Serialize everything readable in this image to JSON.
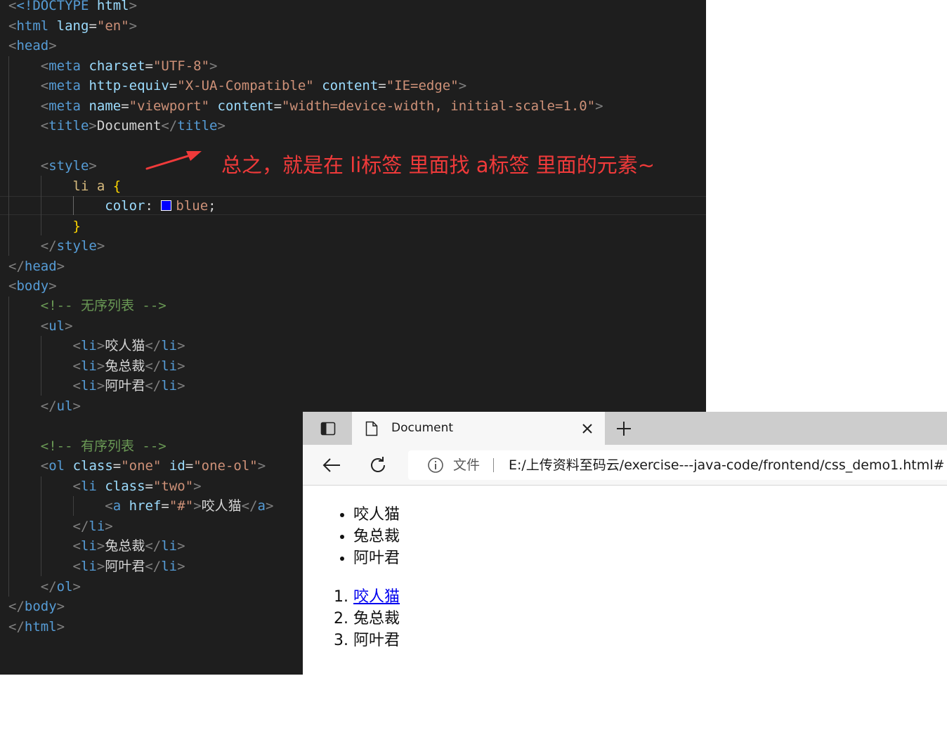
{
  "editor": {
    "code": {
      "doctype_kw": "<!DOCTYPE",
      "doctype_html": "html",
      "head": "head",
      "meta": "meta",
      "charset_attr": "charset",
      "charset_val": "\"UTF-8\"",
      "http_equiv_attr": "http-equiv",
      "http_equiv_val": "\"X-UA-Compatible\"",
      "content_attr": "content",
      "ie_edge_val": "\"IE=edge\"",
      "name_attr": "name",
      "viewport_val": "\"viewport\"",
      "viewport_content_val": "\"width=device-width, initial-scale=1.0\"",
      "title_tag": "title",
      "title_text": "Document",
      "style_tag": "style",
      "css_selector": "li a",
      "css_open": "{",
      "css_property": "color",
      "css_value": "blue",
      "css_close": "}",
      "body_tag": "body",
      "comment_ul": "<!-- 无序列表 -->",
      "ul_tag": "ul",
      "li_tag": "li",
      "item1": "咬人猫",
      "item2": "兔总裁",
      "item3": "阿叶君",
      "comment_ol": "<!-- 有序列表 -->",
      "ol_tag": "ol",
      "class_attr": "class",
      "one_val": "\"one\"",
      "id_attr": "id",
      "one_ol_val": "\"one-ol\"",
      "two_val": "\"two\"",
      "a_tag": "a",
      "href_attr": "href",
      "href_val": "\"#\"",
      "html_tag": "html",
      "lang_attr": "lang",
      "lang_val": "\"en\""
    },
    "swatch_color": "#0000ff",
    "annotation": "总之，就是在 li标签 里面找 a标签 里面的元素~",
    "annotation_color": "#f03a3a"
  },
  "browser": {
    "tab_title": "Document",
    "address_label": "文件",
    "address_url": "E:/上传资料至码云/exercise---java-code/frontend/css_demo1.html#",
    "page": {
      "unordered": [
        "咬人猫",
        "兔总裁",
        "阿叶君"
      ],
      "ordered_link": "咬人猫",
      "ordered": [
        "兔总裁",
        "阿叶君"
      ]
    },
    "link_color": "#0000ee"
  }
}
